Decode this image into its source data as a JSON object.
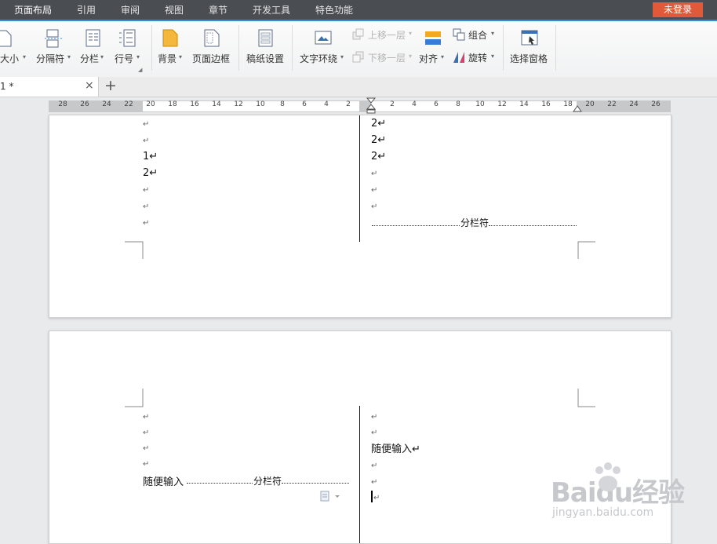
{
  "menu": {
    "tabs": [
      "页面布局",
      "引用",
      "审阅",
      "视图",
      "章节",
      "开发工具",
      "特色功能"
    ],
    "login": "未登录"
  },
  "toolbar": {
    "size_label": "纸张大小",
    "size_visible": "大小",
    "page_break": "分隔符",
    "columns": "分栏",
    "line_number": "行号",
    "background": "背景",
    "page_border": "页面边框",
    "draft_paper": "稿纸设置",
    "text_wrap": "文字环绕",
    "bring_forward": "上移一层",
    "send_backward": "下移一层",
    "align": "对齐",
    "group": "组合",
    "rotate": "旋转",
    "selection_pane": "选择窗格"
  },
  "doc_tab": {
    "title": "1 *",
    "close": "×",
    "new": "+"
  },
  "ruler": {
    "left_numbers": [
      "28",
      "26",
      "24",
      "22",
      "20",
      "18",
      "16",
      "14",
      "12",
      "10",
      "8",
      "6",
      "4",
      "2"
    ],
    "right_numbers": [
      "2",
      "4",
      "6",
      "8",
      "10",
      "12",
      "14",
      "16",
      "18",
      "20",
      "22",
      "24",
      "26"
    ]
  },
  "page1": {
    "left_col": [
      "↵",
      "↵",
      "1↵",
      "2↵",
      "↵",
      "↵",
      "↵"
    ],
    "right_col": [
      "2↵",
      "2↵",
      "2↵",
      "↵",
      "↵",
      "↵"
    ],
    "column_break_label": "分栏符"
  },
  "page2": {
    "left_col": [
      "↵",
      "↵",
      "↵",
      "↵"
    ],
    "left_text": "随便输入",
    "left_break_label": "分栏符",
    "right_col_top": [
      "↵",
      "↵"
    ],
    "right_text": "随便输入↵",
    "right_col_bottom": [
      "↵",
      "↵",
      "↵"
    ]
  },
  "watermark": {
    "brand": "Baidu经验",
    "url": "jingyan.baidu.com"
  }
}
